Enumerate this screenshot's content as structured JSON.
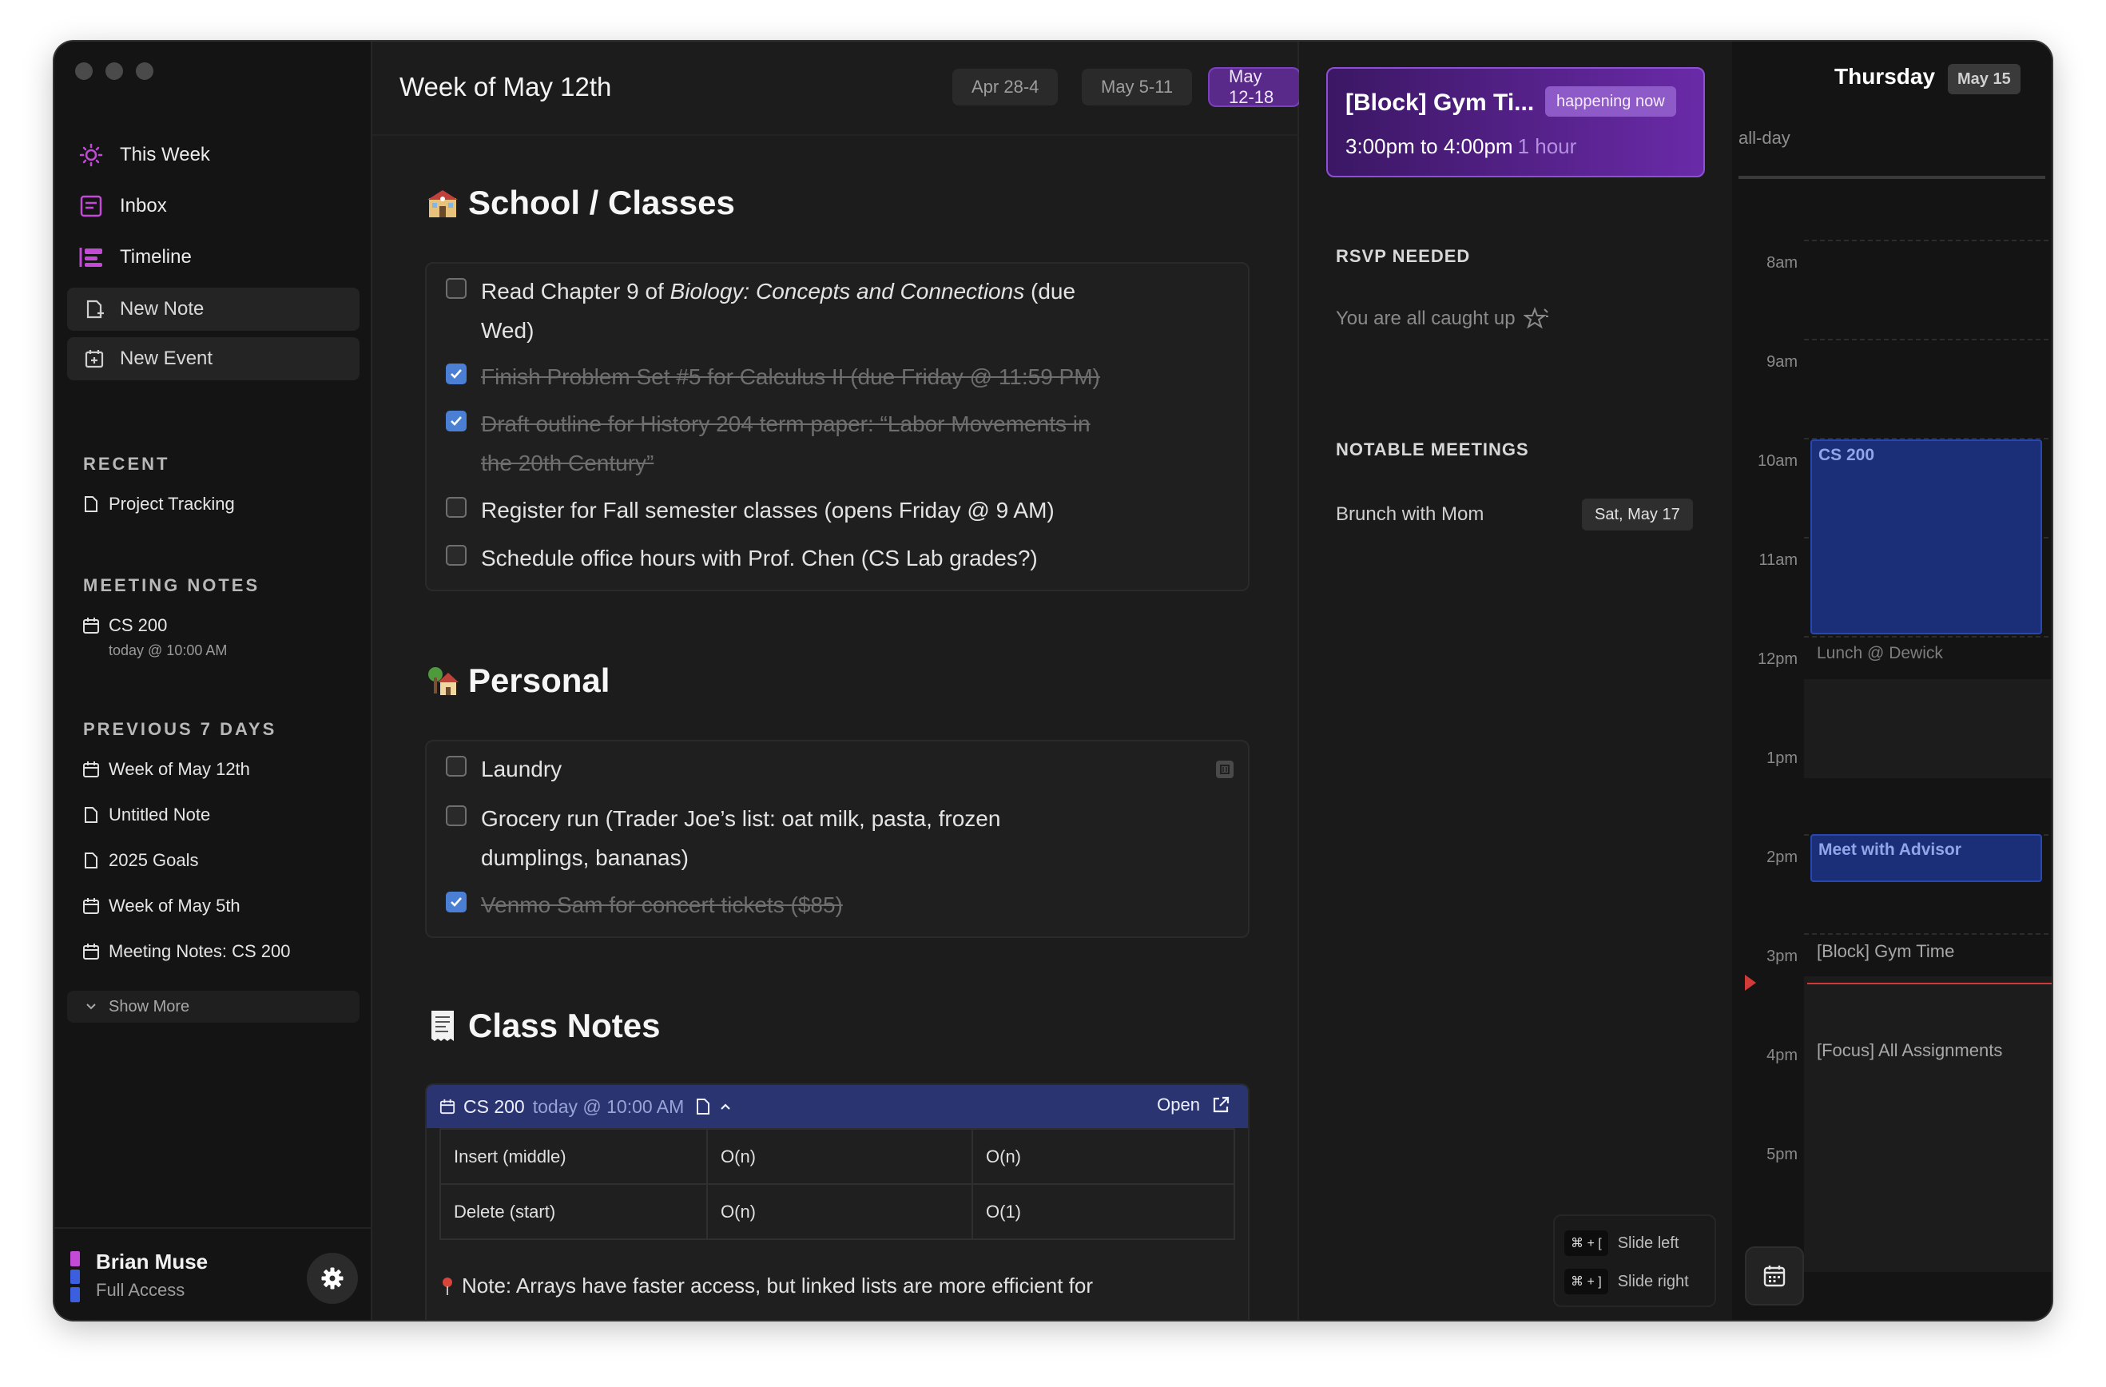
{
  "sidebar": {
    "nav": [
      {
        "label": "This Week",
        "icon": "sun-icon"
      },
      {
        "label": "Inbox",
        "icon": "inbox-icon"
      },
      {
        "label": "Timeline",
        "icon": "timeline-icon"
      }
    ],
    "new_note": "New Note",
    "new_event": "New Event",
    "recent_title": "RECENT",
    "recent": [
      {
        "label": "Project Tracking"
      }
    ],
    "meeting_notes_title": "MEETING NOTES",
    "meeting_notes": [
      {
        "label": "CS 200",
        "sub": "today @ 10:00 AM"
      }
    ],
    "previous_title": "PREVIOUS 7 DAYS",
    "previous": [
      {
        "label": "Week of May 12th",
        "icon": "calendar-icon"
      },
      {
        "label": "Untitled Note",
        "icon": "document-icon"
      },
      {
        "label": "2025 Goals",
        "icon": "document-icon"
      },
      {
        "label": "Week of May 5th",
        "icon": "calendar-icon"
      },
      {
        "label": "Meeting Notes: CS 200",
        "icon": "calendar-icon"
      }
    ],
    "show_more": "Show More",
    "user": {
      "name": "Brian Muse",
      "role": "Full Access"
    }
  },
  "main": {
    "title": "Week of May 12th",
    "week_tabs": [
      "Apr 28-4",
      "May 5-11",
      "May 12-18"
    ],
    "active_tab": "May 12-18",
    "school": {
      "heading": "School / Classes",
      "tasks": [
        {
          "pre": "Read Chapter 9 of ",
          "em": "Biology: Concepts and Connections",
          "post": " (due",
          "post2": "Wed)",
          "done": false
        },
        {
          "text": "Finish Problem Set #5 for Calculus II (due Friday @ 11:59 PM)",
          "done": true
        },
        {
          "text": "Draft outline for History 204 term paper: “Labor Movements in",
          "text2": "the 20th Century”",
          "done": true
        },
        {
          "text": "Register for Fall semester classes (opens Friday @ 9 AM)",
          "done": false
        },
        {
          "text": "Schedule office hours with Prof. Chen (CS Lab grades?)",
          "done": false
        }
      ]
    },
    "personal": {
      "heading": "Personal",
      "tasks": [
        {
          "text": "Laundry",
          "done": false
        },
        {
          "text": "Grocery run (Trader Joe’s list: oat milk, pasta, frozen",
          "text2": "dumplings, bananas)",
          "done": false
        },
        {
          "text": "Venmo Sam for concert tickets ($85)",
          "done": true
        }
      ]
    },
    "class_notes": {
      "heading": "Class Notes",
      "note_title": "CS 200",
      "note_time": "today @ 10:00 AM",
      "open_label": "Open",
      "rows": [
        [
          "Insert (middle)",
          "O(n)",
          "O(n)"
        ],
        [
          "Delete (start)",
          "O(n)",
          "O(1)"
        ]
      ],
      "footer": "Note: Arrays have faster access, but linked lists are more efficient for"
    }
  },
  "panel": {
    "now": {
      "title": "[Block] Gym Ti...",
      "badge": "happening now",
      "time": "3:00pm to 4:00pm",
      "duration": "1 hour"
    },
    "rsvp_title": "RSVP NEEDED",
    "rsvp_empty": "You are all caught up",
    "notable_title": "NOTABLE MEETINGS",
    "notable": [
      {
        "label": "Brunch with Mom",
        "date": "Sat, May 17"
      }
    ],
    "shortcuts": [
      {
        "keys": "⌘ + [",
        "label": "Slide left"
      },
      {
        "keys": "⌘ + ]",
        "label": "Slide right"
      }
    ]
  },
  "calendar": {
    "day": "Thursday",
    "date": "May 15",
    "allday": "all-day",
    "hours": [
      "8am",
      "9am",
      "10am",
      "11am",
      "12pm",
      "1pm",
      "2pm",
      "3pm",
      "4pm",
      "5pm"
    ],
    "events": [
      {
        "title": "CS 200"
      },
      {
        "title": "Lunch @ Dewick"
      },
      {
        "title": "Meet with Advisor"
      },
      {
        "title": "[Block] Gym Time"
      },
      {
        "title": "[Focus] All Assignments"
      }
    ]
  },
  "colors": {
    "accent": "#7b3fc0",
    "event_blue": "#1a2f78",
    "now_line": "#d23a3a"
  }
}
